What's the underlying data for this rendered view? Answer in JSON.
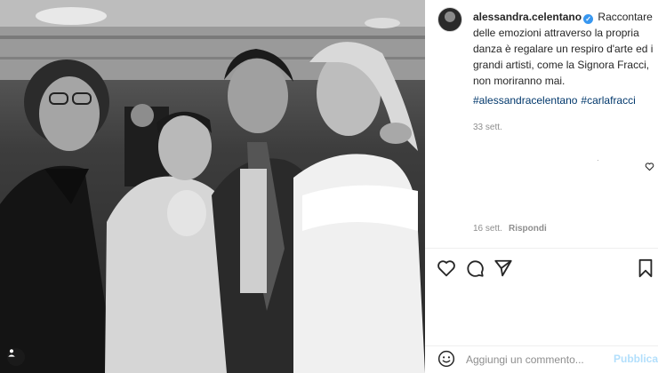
{
  "post": {
    "photo_alt": "",
    "username": "alessandra.celentano",
    "verified": true,
    "caption": "Raccontare delle emozioni attraverso la propria danza è regalare un respiro d'arte ed i grandi artisti, come la Signora Fracci, non moriranno mai.",
    "hashtags": [
      "#alessandracelentano",
      "#carlafracci"
    ],
    "time": "33 sett."
  },
  "comment": {
    "dot": "·",
    "time": "16 sett.",
    "reply_label": "Rispondi"
  },
  "actions": {
    "like_icon": "heart-icon",
    "comment_icon": "comment-icon",
    "share_icon": "share-icon",
    "save_icon": "bookmark-icon"
  },
  "add_comment": {
    "placeholder": "Aggiungi un commento...",
    "publish_label": "Pubblica"
  },
  "colors": {
    "link": "#00376b",
    "muted": "#8e8e8e",
    "publish_disabled": "#b2dffc",
    "verified": "#3897f0"
  }
}
